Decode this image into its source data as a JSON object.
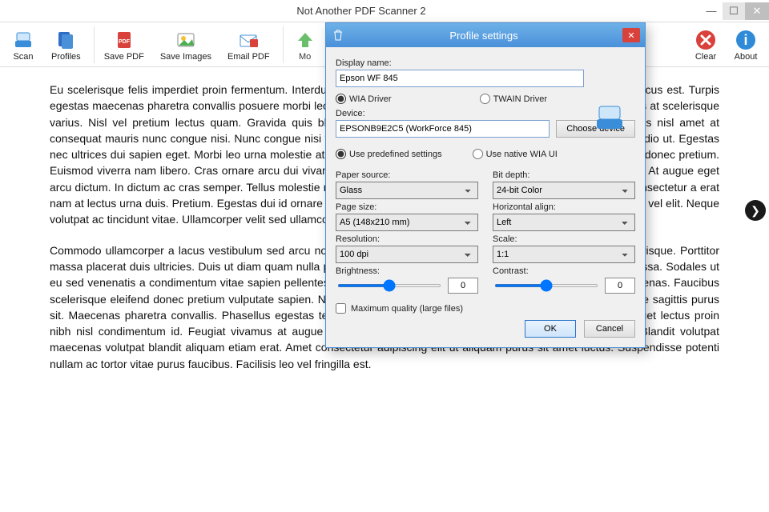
{
  "window": {
    "title": "Not Another PDF Scanner 2"
  },
  "toolbar": {
    "scan": "Scan",
    "profiles": "Profiles",
    "save_pdf": "Save PDF",
    "save_images": "Save Images",
    "email_pdf": "Email PDF",
    "move_up": "Mo",
    "clear": "Clear",
    "about": "About"
  },
  "document": {
    "p1": "Eu scelerisque felis imperdiet proin fermentum. Interdum varius sit amet mattis vulputate enim nulla aliquet porttitor lacus est. Turpis egestas maecenas pharetra convallis posuere morbi leo urna. Vel fringilla est ullamcorper eget. Sed elementum tempus at scelerisque varius. Nisl vel pretium lectus quam. Gravida quis blandit turpis cursus in hac habitasse platea dictumst. Faucibus nisl amet at consequat mauris nunc congue nisi. Nunc congue nisi vitae suscipit tellus mauris. Lacinia at quis risus sed vulputate odio ut. Egestas nec ultrices dui sapien eget. Morbi leo urna molestie at elementum eu facilisis sed odio. Faucibus scelerisque eleifend donec pretium. Euismod viverra nam libero. Cras ornare arcu dui vivamus. Duis ut diam quam nulla porttitor massa id neque aliquam. At augue eget arcu dictum. In dictum ac cras semper. Tellus molestie nunc non blandit massa enim nec dui nunc mattis enim. Non consectetur a erat nam at lectus urna duis. Pretium. Egestas dui id ornare arcu odio ut. A arcu cursus vitae congue mauris rhoncus aenean vel elit. Neque volutpat ac tincidunt vitae. Ullamcorper velit sed ullamcorper morbi tincidunt ornare. Sed cras ornare arcu dui vivamus.",
    "p2": "Commodo ullamcorper a lacus vestibulum sed arcu non odio euismod. Volutpat blandit aliquam etiam erat velit scelerisque. Porttitor massa placerat duis ultricies. Duis ut diam quam nulla porttitor. Eget nunc lobortis mattis aliquam faucibus purus in massa. Sodales ut eu sed venenatis a condimentum vitae sapien pellentesque habitant morbi tristique senectus et. Blandit volutpat maecenas. Faucibus scelerisque eleifend donec pretium vulputate sapien. Non consectetur a erat nam at lectus urna duis. Dictumst quisque sagittis purus sit. Maecenas pharetra convallis. Phasellus egestas tellus rutrum tellus pellentesque eu tincidunt. Nibh tortor id aliquet lectus proin nibh nisl condimentum id. Feugiat vivamus at augue eget arcu. Aliquet sagittis id consectetur purus ut faucibus. Blandit volutpat maecenas volutpat blandit aliquam etiam erat. Amet consectetur adipiscing elit ut aliquam purus sit amet luctus. Suspendisse potenti nullam ac tortor vitae purus faucibus. Facilisis leo vel fringilla est."
  },
  "dialog": {
    "title": "Profile settings",
    "display_name_label": "Display name:",
    "display_name_value": "Epson WF 845",
    "driver_wia": "WIA Driver",
    "driver_twain": "TWAIN Driver",
    "device_label": "Device:",
    "device_value": "EPSONB9E2C5 (WorkForce 845)",
    "choose_device": "Choose device",
    "predef": "Use predefined settings",
    "native": "Use native WIA UI",
    "paper_source_label": "Paper source:",
    "paper_source": "Glass",
    "page_size_label": "Page size:",
    "page_size": "A5 (148x210 mm)",
    "resolution_label": "Resolution:",
    "resolution": "100 dpi",
    "brightness_label": "Brightness:",
    "brightness_value": "0",
    "bit_depth_label": "Bit depth:",
    "bit_depth": "24-bit Color",
    "halign_label": "Horizontal align:",
    "halign": "Left",
    "scale_label": "Scale:",
    "scale": "1:1",
    "contrast_label": "Contrast:",
    "contrast_value": "0",
    "max_quality": "Maximum quality (large files)",
    "ok": "OK",
    "cancel": "Cancel"
  }
}
